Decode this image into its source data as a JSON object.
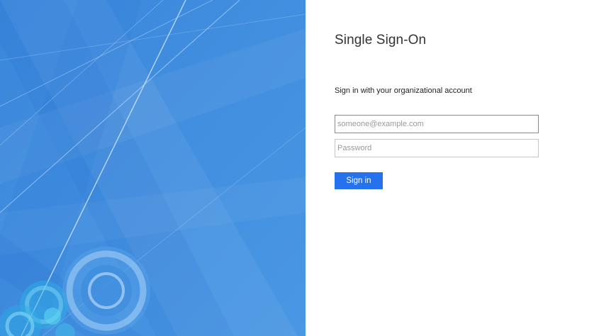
{
  "app": {
    "title": "Single Sign-On"
  },
  "login": {
    "intro": "Sign in with your organizational account",
    "username": {
      "value": "",
      "placeholder": "someone@example.com"
    },
    "password": {
      "value": "",
      "placeholder": "Password"
    },
    "submit_label": "Sign in"
  },
  "colors": {
    "illustration_background": "#3f8fe0",
    "button_background": "#2672ec",
    "button_text": "#ffffff"
  }
}
